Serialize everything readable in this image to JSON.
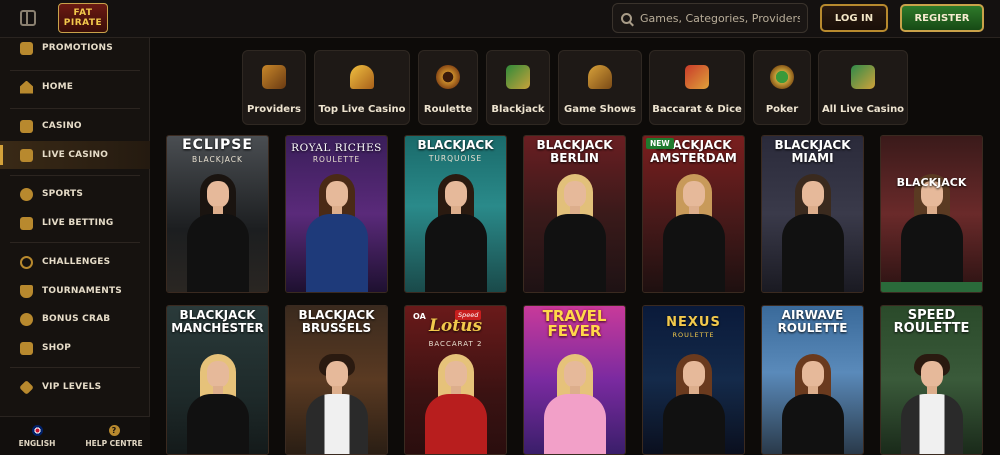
{
  "header": {
    "logo_line1": "FAT",
    "logo_line2": "PIRATE",
    "search_placeholder": "Games, Categories, Providers",
    "login_label": "LOG IN",
    "register_label": "REGISTER"
  },
  "sidebar": {
    "items": [
      {
        "label": "PROMOTIONS",
        "icon": "gift-icon"
      },
      {
        "label": "HOME",
        "icon": "home-icon"
      },
      {
        "label": "CASINO",
        "icon": "casino-icon"
      },
      {
        "label": "LIVE CASINO",
        "icon": "live-casino-icon",
        "active": true
      },
      {
        "label": "SPORTS",
        "icon": "soccer-ball-icon"
      },
      {
        "label": "LIVE BETTING",
        "icon": "live-betting-icon"
      },
      {
        "label": "CHALLENGES",
        "icon": "challenges-icon"
      },
      {
        "label": "TOURNAMENTS",
        "icon": "trophy-icon"
      },
      {
        "label": "BONUS CRAB",
        "icon": "crab-icon"
      },
      {
        "label": "SHOP",
        "icon": "shop-icon"
      },
      {
        "label": "VIP LEVELS",
        "icon": "diamond-icon"
      }
    ],
    "language_label": "ENGLISH",
    "help_label": "HELP CENTRE",
    "help_glyph": "?"
  },
  "categories": [
    {
      "label": "Providers",
      "icon": "treasure-map-icon"
    },
    {
      "label": "Top Live Casino",
      "icon": "torch-icon"
    },
    {
      "label": "Roulette",
      "icon": "roulette-icon"
    },
    {
      "label": "Blackjack",
      "icon": "cards-icon"
    },
    {
      "label": "Game Shows",
      "icon": "game-show-icon"
    },
    {
      "label": "Baccarat & Dice",
      "icon": "dice-icon"
    },
    {
      "label": "Poker",
      "icon": "poker-chips-icon"
    },
    {
      "label": "All Live Casino",
      "icon": "all-live-casino-icon"
    }
  ],
  "games_row1": [
    {
      "title": "ECLIPSE",
      "subtitle": "BLACKJACK"
    },
    {
      "title": "ROYAL RICHES",
      "subtitle": "ROULETTE"
    },
    {
      "title": "BLACKJACK",
      "subtitle": "TURQUOISE"
    },
    {
      "title": "BLACKJACK BERLIN",
      "subtitle": ""
    },
    {
      "title": "BLACKJACK AMSTERDAM",
      "subtitle": "",
      "badge": "NEW"
    },
    {
      "title": "BLACKJACK MIAMI",
      "subtitle": ""
    },
    {
      "title": "BLACKJACK",
      "subtitle": ""
    }
  ],
  "games_row2": [
    {
      "title": "BLACKJACK MANCHESTER",
      "subtitle": ""
    },
    {
      "title": "BLACKJACK BRUSSELS",
      "subtitle": ""
    },
    {
      "title": "Lotus",
      "subtitle": "BACCARAT 2",
      "brand": "OA",
      "tag": "Speed"
    },
    {
      "title": "TRAVEL FEVER",
      "subtitle": ""
    },
    {
      "title": "NEXUS",
      "subtitle": "ROULETTE"
    },
    {
      "title": "AIRWAVE ROULETTE",
      "subtitle": ""
    },
    {
      "title": "SPEED ROULETTE",
      "subtitle": ""
    }
  ],
  "colors": {
    "accent_gold": "#c9a24a",
    "register_green": "#2e7a2a",
    "background": "#0d0b09"
  }
}
